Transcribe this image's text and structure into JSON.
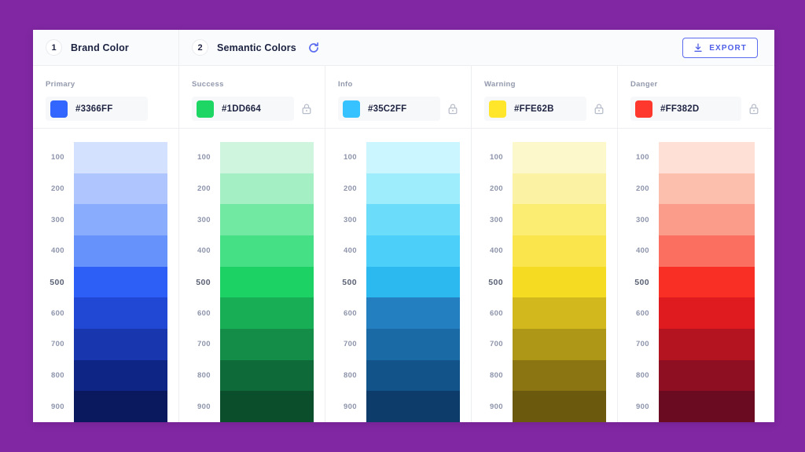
{
  "background_color": "#8127A3",
  "header": {
    "steps": [
      {
        "number": "1",
        "label": "Brand Color"
      },
      {
        "number": "2",
        "label": "Semantic Colors"
      }
    ],
    "refresh_icon": "refresh-icon",
    "export_label": "EXPORT",
    "export_icon": "download-icon",
    "accent_color": "#4f5fe8"
  },
  "scale_steps": [
    "100",
    "200",
    "300",
    "400",
    "500",
    "600",
    "700",
    "800",
    "900"
  ],
  "base_step": "500",
  "columns": [
    {
      "role": "Primary",
      "hex": "#3366FF",
      "locked": false,
      "lock_icon": null,
      "ramp": [
        "#D3E0FE",
        "#AEC6FD",
        "#8AACFC",
        "#6693FB",
        "#2D5EF6",
        "#2148D4",
        "#1836AE",
        "#0F2585",
        "#0A195E"
      ]
    },
    {
      "role": "Success",
      "hex": "#1DD664",
      "locked": true,
      "lock_icon": "lock-icon",
      "ramp": [
        "#CFF5DF",
        "#A5EFC4",
        "#72E9A3",
        "#45E085",
        "#1DD264",
        "#17AE55",
        "#138D48",
        "#0E6A39",
        "#0A4E2C"
      ]
    },
    {
      "role": "Info",
      "hex": "#35C2FF",
      "locked": true,
      "lock_icon": "lock-icon",
      "ramp": [
        "#CCF6FF",
        "#9DEDFD",
        "#6BDDFB",
        "#4CD0FA",
        "#2CB9F0",
        "#237FC0",
        "#1A6AA6",
        "#12538A",
        "#0D3C6B"
      ]
    },
    {
      "role": "Warning",
      "hex": "#FFE62B",
      "locked": true,
      "lock_icon": "lock-icon",
      "ramp": [
        "#FDF8CC",
        "#FCF2A3",
        "#FBEC72",
        "#FAE64C",
        "#F5DB22",
        "#D2B81C",
        "#AE9617",
        "#8A7512",
        "#6B5A0E"
      ]
    },
    {
      "role": "Danger",
      "hex": "#FF382D",
      "locked": true,
      "lock_icon": "lock-icon",
      "ramp": [
        "#FEE0D6",
        "#FCBFAE",
        "#FB9B89",
        "#FA6F5F",
        "#F92E24",
        "#E01B1F",
        "#B4141F",
        "#8E0F22",
        "#6B0B22"
      ]
    }
  ]
}
